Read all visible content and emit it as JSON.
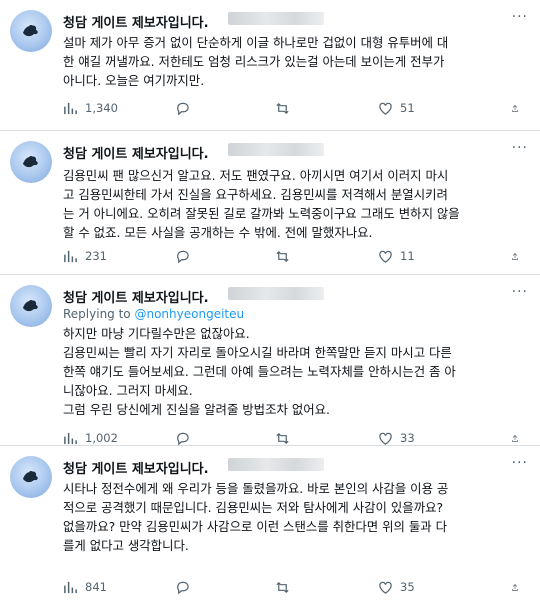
{
  "tweets": [
    {
      "author": "청담 게이트 제보자입니다.",
      "reply_label": "",
      "reply_mention": "",
      "lines": [
        "설마 제가 아무 증거 없이 단순하게 이글 하나로만 겁없이 대형 유투버에 대",
        "한 얘길 꺼낼까요. 저한테도 엄청 리스크가 있는걸 아는데 보이는게 전부가",
        "아니다. 오늘은 여기까지만."
      ],
      "views": "1,340",
      "replies": "",
      "retweets": "",
      "likes": "51"
    },
    {
      "author": "청담 게이트 제보자입니다.",
      "reply_label": "",
      "reply_mention": "",
      "lines": [
        "김용민씨 팬 많으신거 알고요. 저도 팬였구요. 아끼시면 여기서 이러지 마시",
        "고 김용민씨한테 가서 진실을 요구하세요. 김용민씨를 저격해서 분열시키려",
        "는 거 아니에요. 오히려 잘못된 길로 갈까봐 노력중이구요 그래도 변하지 않을",
        "할 수 없죠. 모든 사실을 공개하는 수 밖에. 전에 말했자나요."
      ],
      "views": "231",
      "replies": "",
      "retweets": "",
      "likes": "11"
    },
    {
      "author": "청담 게이트 제보자입니다.",
      "reply_label": "Replying to",
      "reply_mention": "@nonhyeongeiteu",
      "lines": [
        "하지만 마냥 기다릴수만은 없잖아요.",
        "김용민씨는 빨리 자기 자리로 돌아오시길 바라며 한쪽말만 듣지 마시고 다른",
        "한쪽 얘기도 들어보세요. 그런데 아예 들으려는 노력자체를 안하시는건 좀 아",
        "니잖아요. 그러지 마세요.",
        "그럼 우린 당신에게 진실을 알려줄 방법조차 없어요."
      ],
      "views": "1,002",
      "replies": "",
      "retweets": "",
      "likes": "33"
    },
    {
      "author": "청담 게이트 제보자입니다.",
      "reply_label": "",
      "reply_mention": "",
      "lines": [
        "시타나 정전수에게 왜 우리가 등을 돌렸을까요. 바로 본인의 사감을 이용 공",
        "적으로 공격했기 때문입니다. 김용민씨는 저와 탐사에게 사감이 있을까요?",
        "없을까요? 만약 김용민씨가 사감으로 이런 스탠스를 취한다면 위의 둘과 다",
        "를게 없다고 생각합니다."
      ],
      "views": "841",
      "replies": "",
      "retweets": "",
      "likes": "35"
    }
  ]
}
